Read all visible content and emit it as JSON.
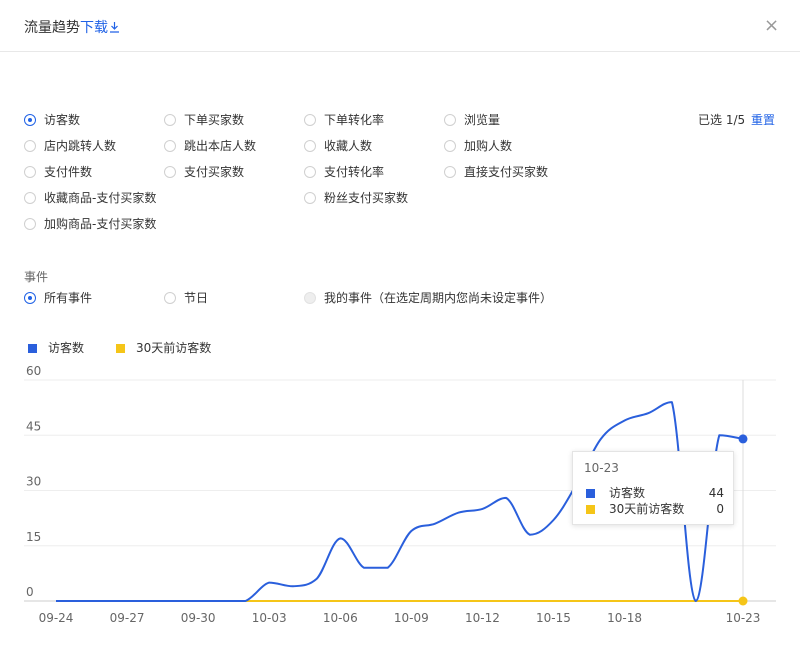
{
  "header": {
    "title": "流量趋势",
    "download_label": "下载",
    "download_icon": "download-icon",
    "close_icon": "close-icon",
    "close_glyph": "×"
  },
  "metrics": {
    "items": [
      {
        "label": "访客数",
        "checked": true
      },
      {
        "label": "下单买家数",
        "checked": false
      },
      {
        "label": "下单转化率",
        "checked": false
      },
      {
        "label": "浏览量",
        "checked": false
      },
      {
        "label": "店内跳转人数",
        "checked": false
      },
      {
        "label": "跳出本店人数",
        "checked": false
      },
      {
        "label": "收藏人数",
        "checked": false
      },
      {
        "label": "加购人数",
        "checked": false
      },
      {
        "label": "支付件数",
        "checked": false
      },
      {
        "label": "支付买家数",
        "checked": false
      },
      {
        "label": "支付转化率",
        "checked": false
      },
      {
        "label": "直接支付买家数",
        "checked": false
      },
      {
        "label": "收藏商品-支付买家数",
        "checked": false
      },
      {
        "label": "粉丝支付买家数",
        "checked": false
      },
      {
        "label": "加购商品-支付买家数",
        "checked": false
      }
    ],
    "selected_text": "已选 1/5",
    "reset_label": "重置"
  },
  "events": {
    "label": "事件",
    "items": [
      {
        "label": "所有事件",
        "checked": true,
        "disabled": false
      },
      {
        "label": "节日",
        "checked": false,
        "disabled": false
      },
      {
        "label": "我的事件（在选定周期内您尚未设定事件）",
        "checked": false,
        "disabled": true
      }
    ]
  },
  "colors": {
    "primary": "#2062e6",
    "visitors": "#2a5fdc",
    "visitors_30d": "#f5c518",
    "grid": "#eeeeee",
    "axis": "#cccccc"
  },
  "chart_data": {
    "type": "line",
    "x": [
      "09-24",
      "09-25",
      "09-26",
      "09-27",
      "09-28",
      "09-29",
      "09-30",
      "10-01",
      "10-02",
      "10-03",
      "10-04",
      "10-05",
      "10-06",
      "10-07",
      "10-08",
      "10-09",
      "10-10",
      "10-11",
      "10-12",
      "10-13",
      "10-14",
      "10-15",
      "10-16",
      "10-17",
      "10-18",
      "10-19",
      "10-20",
      "10-21",
      "10-22",
      "10-23"
    ],
    "xticks": [
      "09-24",
      "09-27",
      "09-30",
      "10-03",
      "10-06",
      "10-09",
      "10-12",
      "10-15",
      "10-18",
      "10-23"
    ],
    "yticks": [
      0,
      15,
      30,
      45,
      60
    ],
    "ylim": [
      0,
      60
    ],
    "series": [
      {
        "name": "访客数",
        "color": "#2a5fdc",
        "values": [
          0,
          0,
          0,
          0,
          0,
          0,
          0,
          0,
          0,
          5,
          4,
          6,
          17,
          9,
          9,
          19,
          21,
          24,
          25,
          28,
          18,
          22,
          32,
          44,
          49,
          51,
          54,
          0,
          45,
          44
        ]
      },
      {
        "name": "30天前访客数",
        "color": "#f5c518",
        "values": [
          0,
          0,
          0,
          0,
          0,
          0,
          0,
          0,
          0,
          0,
          0,
          0,
          0,
          0,
          0,
          0,
          0,
          0,
          0,
          0,
          0,
          0,
          0,
          0,
          0,
          0,
          0,
          0,
          0,
          0
        ]
      }
    ],
    "grid": true,
    "legend_position": "top-left",
    "tooltip": {
      "title": "10-23",
      "rows": [
        {
          "name": "访客数",
          "value": "44",
          "color": "#2a5fdc"
        },
        {
          "name": "30天前访客数",
          "value": "0",
          "color": "#f5c518"
        }
      ]
    }
  }
}
